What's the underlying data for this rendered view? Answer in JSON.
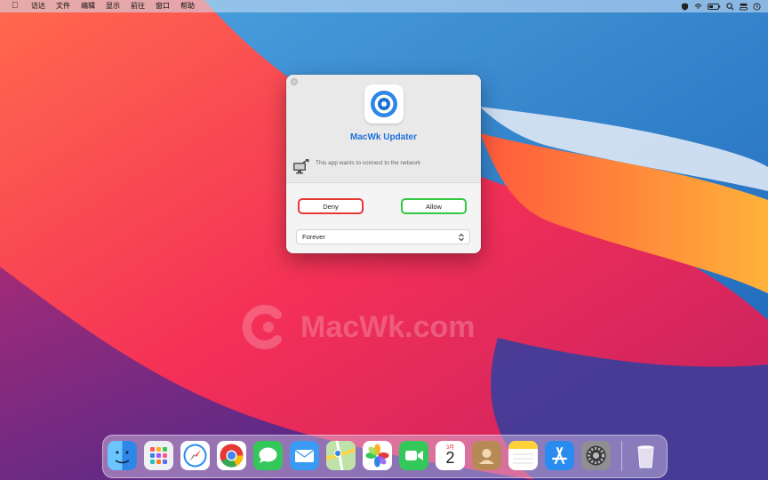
{
  "menubar": {
    "apple_icon": "apple-icon",
    "items": [
      "访达",
      "文件",
      "编辑",
      "显示",
      "前往",
      "窗口",
      "帮助"
    ],
    "status_icons": [
      "shield-icon",
      "wifi-icon",
      "battery-icon",
      "search-icon",
      "control-center-icon",
      "clock-icon"
    ]
  },
  "watermark": {
    "text": "MacWk.com"
  },
  "dialog": {
    "app_title": "MacWk Updater",
    "message": "This app wants to connect to the network",
    "deny_label": "Deny",
    "allow_label": "Allow",
    "duration_value": "Forever",
    "colors": {
      "title": "#1e6fd9",
      "deny_border": "#e53935",
      "allow_border": "#32c840"
    }
  },
  "dock": {
    "items": [
      "finder-icon",
      "launchpad-icon",
      "safari-icon",
      "chrome-icon",
      "messages-icon",
      "mail-icon",
      "maps-icon",
      "photos-icon",
      "facetime-icon",
      "calendar-icon",
      "contacts-icon",
      "notes-icon",
      "app-store-icon",
      "system-preferences-icon",
      "trash-icon"
    ],
    "calendar": {
      "month": "3月",
      "day": "2"
    }
  }
}
